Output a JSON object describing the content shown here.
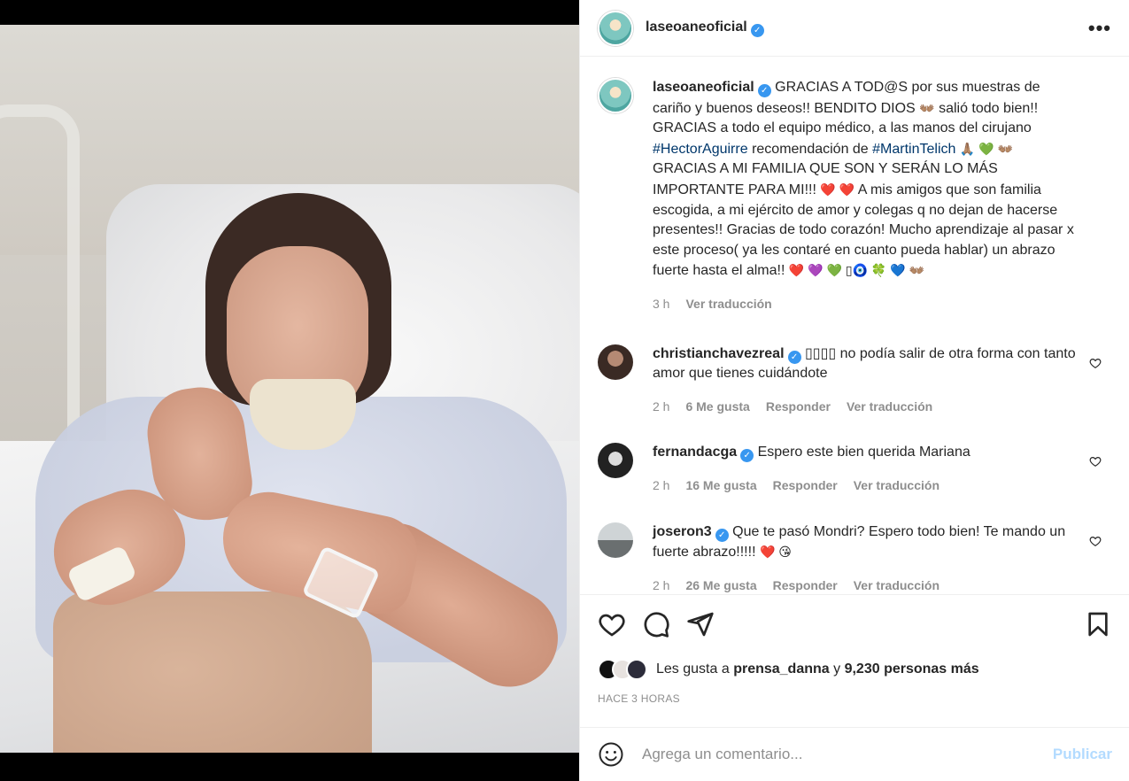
{
  "post": {
    "username": "laseoaneoficial",
    "more_label": "•••"
  },
  "caption": {
    "username": "laseoaneoficial",
    "text_1": "GRACIAS A TOD@S por sus muestras de cariño y buenos deseos!! BENDITO DIOS",
    "emoji_1": "👐🏽",
    "text_2": "salió todo bien!! GRACIAS a todo el equipo médico, a las manos del cirujano",
    "tag_1": "#HectorAguirre",
    "text_3": "recomendación de",
    "tag_2": "#MartinTelich",
    "emoji_2": "🙏🏽 💚 👐🏽",
    "text_4": "GRACIAS A MI FAMILIA QUE SON Y SERÁN LO MÁS IMPORTANTE PARA MI!!!",
    "emoji_3": "❤️ ❤️",
    "text_5": "A mis amigos que son familia escogida, a mi ejército de amor y colegas q no dejan de hacerse presentes!! Gracias de todo corazón! Mucho aprendizaje al pasar x este proceso( ya les contaré en cuanto pueda hablar) un abrazo fuerte hasta el alma!!",
    "emoji_4": "❤️ 💜 💚 ▯🧿 🍀 💙 👐🏽",
    "time": "3 h",
    "translate": "Ver traducción"
  },
  "comments": [
    {
      "username": "christianchavezreal",
      "text": "▯▯▯▯ no podía salir de otra forma con tanto amor que tienes cuidándote",
      "time": "2 h",
      "likes": "6 Me gusta",
      "reply": "Responder",
      "translate": "Ver traducción"
    },
    {
      "username": "fernandacga",
      "text": "Espero este bien querida Mariana",
      "time": "2 h",
      "likes": "16 Me gusta",
      "reply": "Responder",
      "translate": "Ver traducción"
    },
    {
      "username": "joseron3",
      "text": "Que te pasó Mondri? Espero todo bien! Te mando un fuerte abrazo!!!!!",
      "emoji": "❤️ 😘",
      "time": "2 h",
      "likes": "26 Me gusta",
      "reply": "Responder",
      "translate": "Ver traducción"
    }
  ],
  "likes": {
    "prefix": "Les gusta a",
    "user": "prensa_danna",
    "connector": "y",
    "count": "9,230 personas más"
  },
  "time_ago": "HACE 3 HORAS",
  "add_comment": {
    "placeholder": "Agrega un comentario...",
    "publish": "Publicar"
  },
  "colors": {
    "verified": "#3897f0",
    "hashtag": "#00376b",
    "publish_disabled": "#b3dbff",
    "secondary_text": "#8e8e8e"
  }
}
